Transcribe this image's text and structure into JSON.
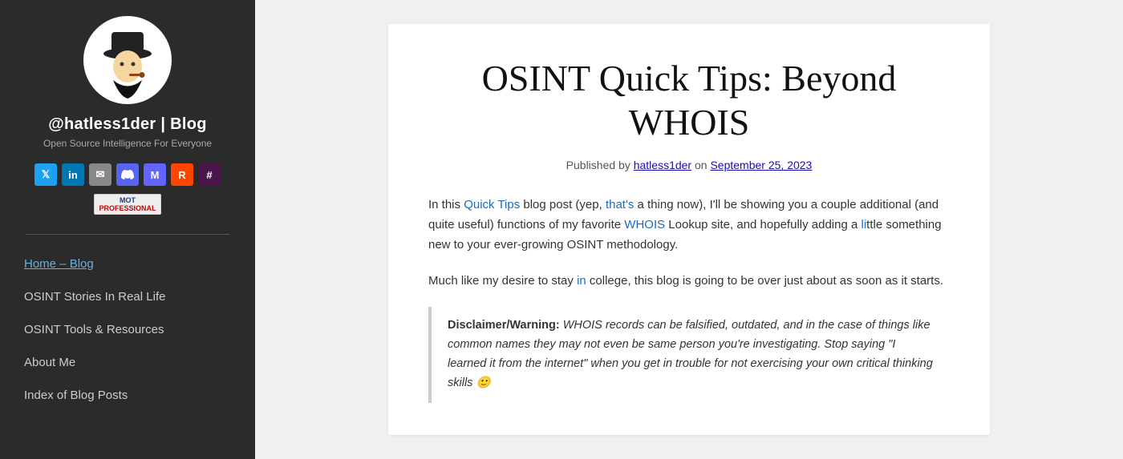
{
  "sidebar": {
    "logo_alt": "hatless1der logo",
    "site_title": "@hatless1der | Blog",
    "site_subtitle": "Open Source Intelligence For Everyone",
    "social_icons": [
      {
        "name": "Twitter",
        "label": "𝕏",
        "type": "twitter"
      },
      {
        "name": "LinkedIn",
        "label": "in",
        "type": "linkedin"
      },
      {
        "name": "Email",
        "label": "✉",
        "type": "mail"
      },
      {
        "name": "Discord",
        "label": "D",
        "type": "discord"
      },
      {
        "name": "Mastodon",
        "label": "M",
        "type": "mastodon"
      },
      {
        "name": "Reddit",
        "label": "R",
        "type": "reddit"
      },
      {
        "name": "Slack",
        "label": "#",
        "type": "slack"
      }
    ],
    "mot_badge_line1": "MOT",
    "mot_badge_line2": "PROFESSIONAL",
    "nav_items": [
      {
        "label": "Home – Blog",
        "active": true,
        "key": "home"
      },
      {
        "label": "OSINT Stories In Real Life",
        "active": false,
        "key": "osint-stories"
      },
      {
        "label": "OSINT Tools & Resources",
        "active": false,
        "key": "osint-tools"
      },
      {
        "label": "About Me",
        "active": false,
        "key": "about"
      },
      {
        "label": "Index of Blog Posts",
        "active": false,
        "key": "index"
      }
    ]
  },
  "article": {
    "title": "OSINT Quick Tips: Beyond WHOIS",
    "meta_prefix": "Published by ",
    "meta_author": "hatless1der",
    "meta_on": " on ",
    "meta_date": "September 25, 2023",
    "para1": "In this Quick Tips blog post (yep, that's a thing now), I'll be showing you a couple additional (and quite useful) functions of my favorite WHOIS Lookup site, and hopefully adding a little something new to your ever-growing OSINT methodology.",
    "para2": "Much like my desire to stay in college, this blog is going to be over just about as soon as it starts.",
    "blockquote": {
      "bold": "Disclaimer/Warning:",
      "text": " WHOIS records can be falsified, outdated, and in the case of things like common names they may not even be same person you're investigating. Stop saying \"I learned it from the internet\" when you get in trouble for not exercising your own critical thinking skills 🙂"
    }
  }
}
